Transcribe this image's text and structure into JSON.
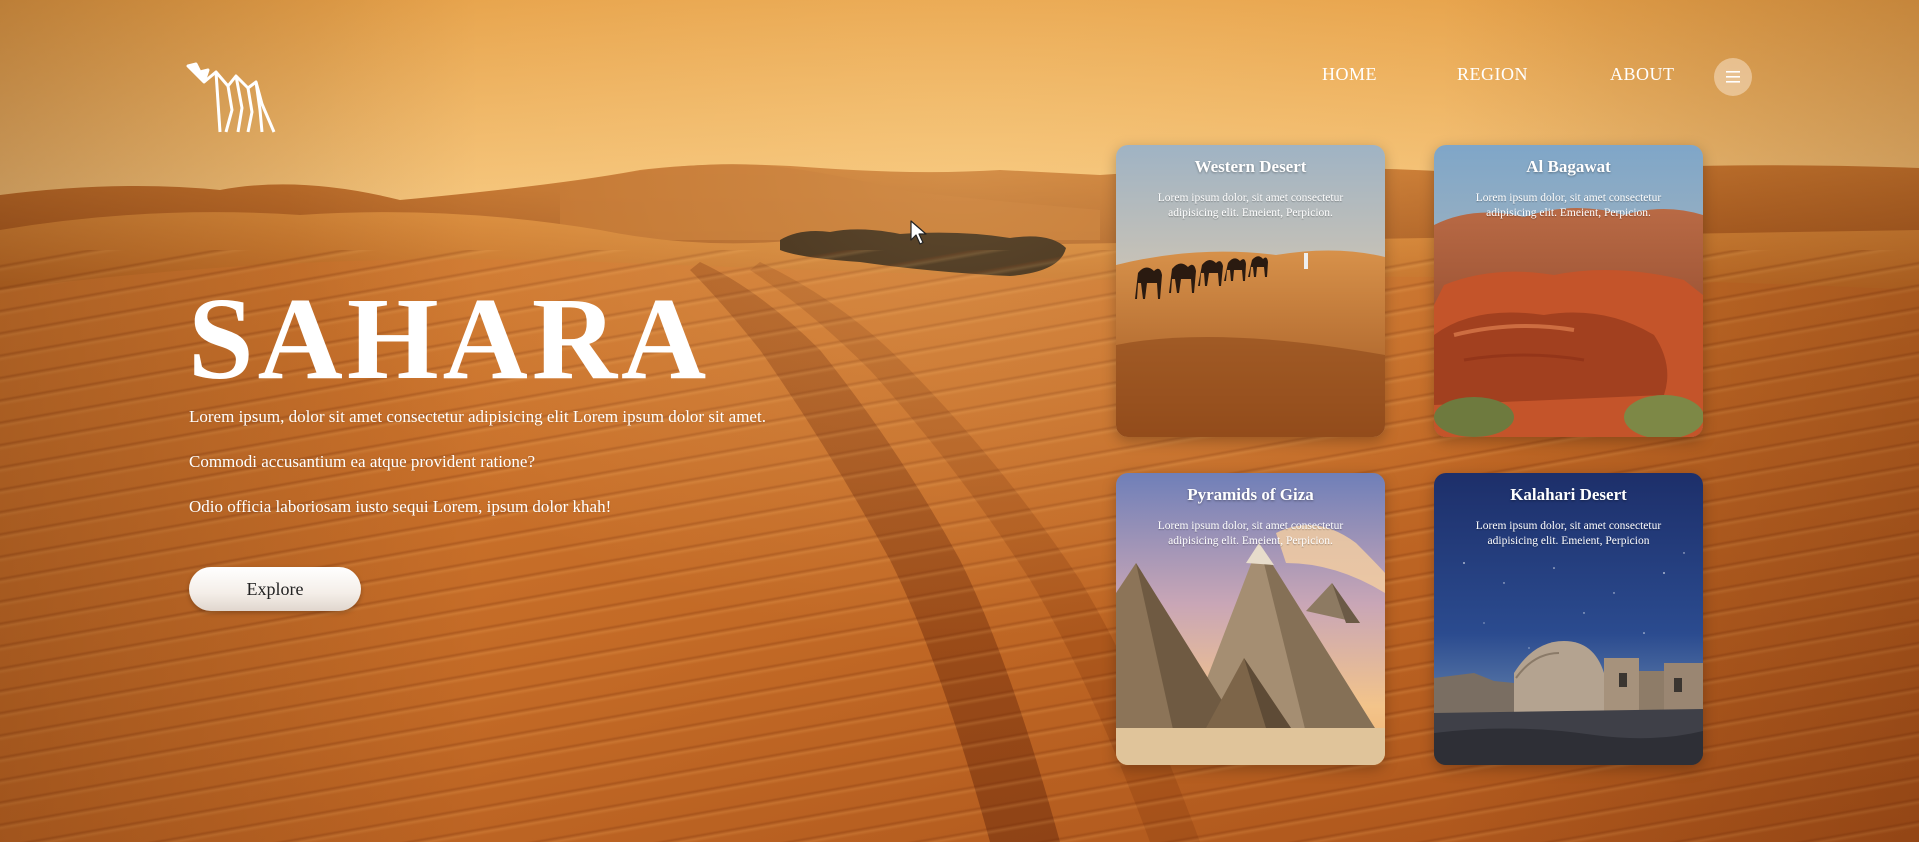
{
  "nav": {
    "home": "HOME",
    "region": "REGION",
    "about": "ABOUT",
    "menu_icon": "hamburger-icon"
  },
  "logo_icon": "camel-logo",
  "hero": {
    "title": "SAHARA",
    "paragraphs": [
      "Lorem ipsum, dolor sit amet consectetur adipisicing elit Lorem ipsum dolor sit amet.",
      "Commodi accusantium ea atque provident ratione?",
      "Odio officia laboriosam iusto sequi Lorem, ipsum dolor khah!"
    ],
    "button_label": "Explore"
  },
  "cards": [
    {
      "title": "Western Desert",
      "desc": "Lorem ipsum dolor, sit amet consectetur adipisicing elit. Emeient, Perpicion.",
      "image": "camel-caravan-dunes"
    },
    {
      "title": "Al Bagawat",
      "desc": "Lorem ipsum dolor, sit amet consectetur adipisicing elit. Emeient, Perpicion.",
      "image": "red-rock-canyon"
    },
    {
      "title": "Pyramids of Giza",
      "desc": "Lorem ipsum dolor, sit amet consectetur adipisicing elit. Emeient, Perpicion.",
      "image": "pyramids"
    },
    {
      "title": "Kalahari Desert",
      "desc": "Lorem ipsum dolor, sit amet consectetur adipisicing elit. Emeient, Perpicion",
      "image": "night-sky-ruins"
    }
  ],
  "colors": {
    "sand_light": "#e59a3e",
    "sand_dark": "#a84a18",
    "sky": "#f0b25a",
    "button_bg": "#ffffff",
    "button_text": "#222222"
  }
}
